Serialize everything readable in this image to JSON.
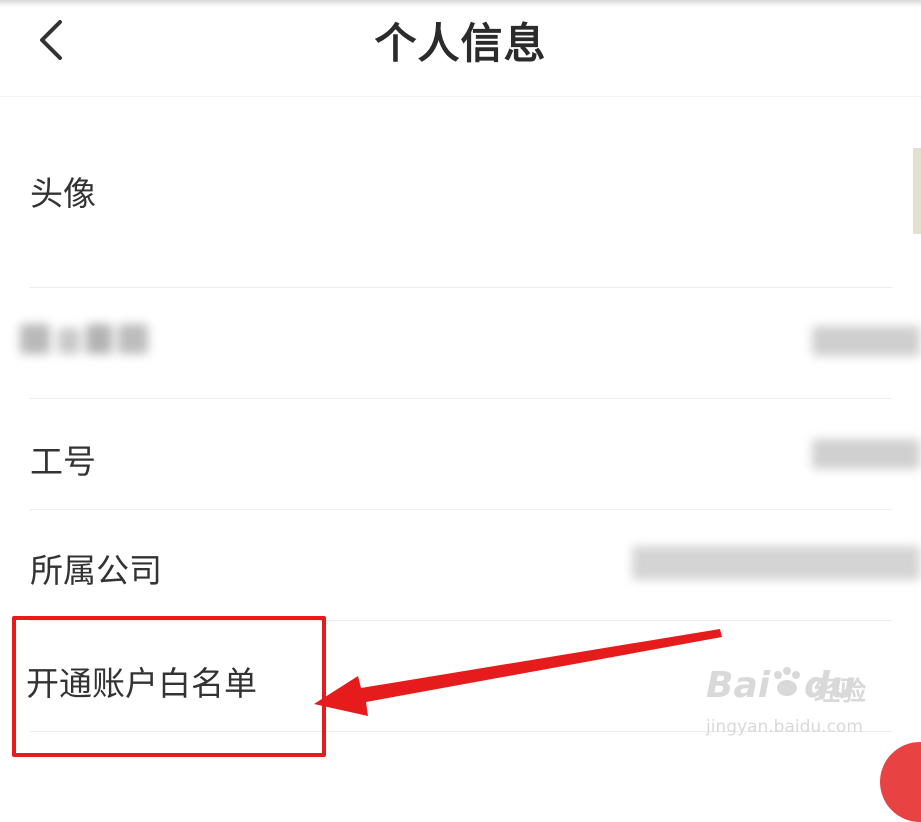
{
  "header": {
    "title": "个人信息",
    "back_icon": "chevron-left-icon"
  },
  "rows": [
    {
      "label": "头像",
      "value": ""
    },
    {
      "label": "",
      "value": ""
    },
    {
      "label": "工号",
      "value": ""
    },
    {
      "label": "所属公司",
      "value": ""
    },
    {
      "label": "开通账户白名单",
      "value": ""
    }
  ],
  "watermark": {
    "logo": "Bai",
    "logo_tail": "du",
    "jingyan": "经验",
    "url": "jingyan.baidu.com"
  },
  "colors": {
    "highlight": "#e61b1b",
    "text": "#333333",
    "divider": "#ececec",
    "watermark": "#d9d9d9"
  }
}
